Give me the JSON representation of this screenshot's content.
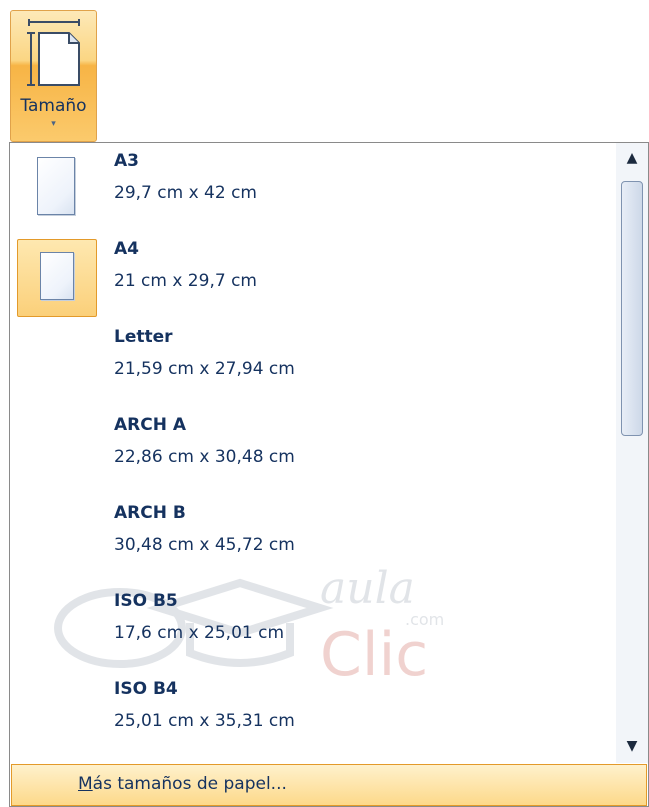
{
  "ribbon": {
    "size_button": {
      "label": "Tamaño",
      "arrow": "▾",
      "icon": "page-size-icon"
    }
  },
  "paper_sizes": [
    {
      "name": "A3",
      "size": "29,7 cm x 42 cm",
      "icon": "page-icon"
    },
    {
      "name": "A4",
      "size": "21 cm x 29,7 cm",
      "icon": "page-icon",
      "selected": true
    },
    {
      "name": "Letter",
      "size": "21,59 cm x 27,94 cm"
    },
    {
      "name": "ARCH A",
      "size": "22,86 cm x 30,48 cm"
    },
    {
      "name": "ARCH B",
      "size": "30,48 cm x 45,72 cm"
    },
    {
      "name": "ISO B5",
      "size": "17,6 cm x 25,01 cm"
    },
    {
      "name": "ISO B4",
      "size": "25,01 cm x 35,31 cm"
    }
  ],
  "more_sizes": {
    "label_first": "M",
    "label_rest": "ás tamaños de papel..."
  },
  "scrollbar": {
    "up_arrow": "▲",
    "down_arrow": "▼"
  },
  "watermark": {
    "line1": "aula",
    "line2": "Clic",
    "suffix": ".com"
  },
  "colors": {
    "accent_orange": "#f7b445",
    "text_navy": "#15325f",
    "highlight_border": "#e39a2a"
  }
}
